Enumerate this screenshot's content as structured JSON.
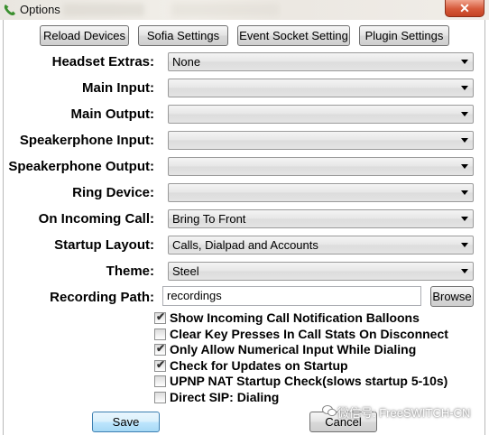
{
  "window": {
    "title": "Options",
    "close_glyph": "✕"
  },
  "top_buttons": {
    "reload_devices": "Reload Devices",
    "sofia_settings": "Sofia Settings",
    "event_socket_setting": "Event Socket Setting",
    "plugin_settings": "Plugin Settings"
  },
  "fields": {
    "headset_extras": {
      "label": "Headset Extras:",
      "value": "None"
    },
    "main_input": {
      "label": "Main Input:",
      "value": ""
    },
    "main_output": {
      "label": "Main Output:",
      "value": ""
    },
    "speakerphone_input": {
      "label": "Speakerphone Input:",
      "value": ""
    },
    "speakerphone_output": {
      "label": "Speakerphone Output:",
      "value": ""
    },
    "ring_device": {
      "label": "Ring Device:",
      "value": ""
    },
    "on_incoming_call": {
      "label": "On Incoming Call:",
      "value": "Bring To Front"
    },
    "startup_layout": {
      "label": "Startup Layout:",
      "value": "Calls, Dialpad and Accounts"
    },
    "theme": {
      "label": "Theme:",
      "value": "Steel"
    },
    "recording_path": {
      "label": "Recording Path:",
      "value": "recordings",
      "browse_label": "Browse"
    }
  },
  "checkboxes": [
    {
      "label": "Show Incoming Call Notification Balloons",
      "checked": true
    },
    {
      "label": "Clear Key Presses In Call Stats On Disconnect",
      "checked": false
    },
    {
      "label": "Only Allow Numerical Input While Dialing",
      "checked": true
    },
    {
      "label": "Check for Updates on Startup",
      "checked": true
    },
    {
      "label": "UPNP NAT Startup Check(slows startup 5-10s)",
      "checked": false
    },
    {
      "label": "Direct SIP: Dialing",
      "checked": false
    }
  ],
  "bottom_buttons": {
    "save": "Save",
    "cancel": "Cancel"
  },
  "watermark": "微信号: FreeSWITCH-CN",
  "icons": {
    "app": "phone-handset-icon",
    "dropdown": "dropdown-arrow-icon",
    "check": "checkmark-icon",
    "watermark": "wechat-icon"
  },
  "colors": {
    "close_button": "#d6593a",
    "default_button_border": "#3c7fb1",
    "app_icon": "#3a8f2e"
  }
}
